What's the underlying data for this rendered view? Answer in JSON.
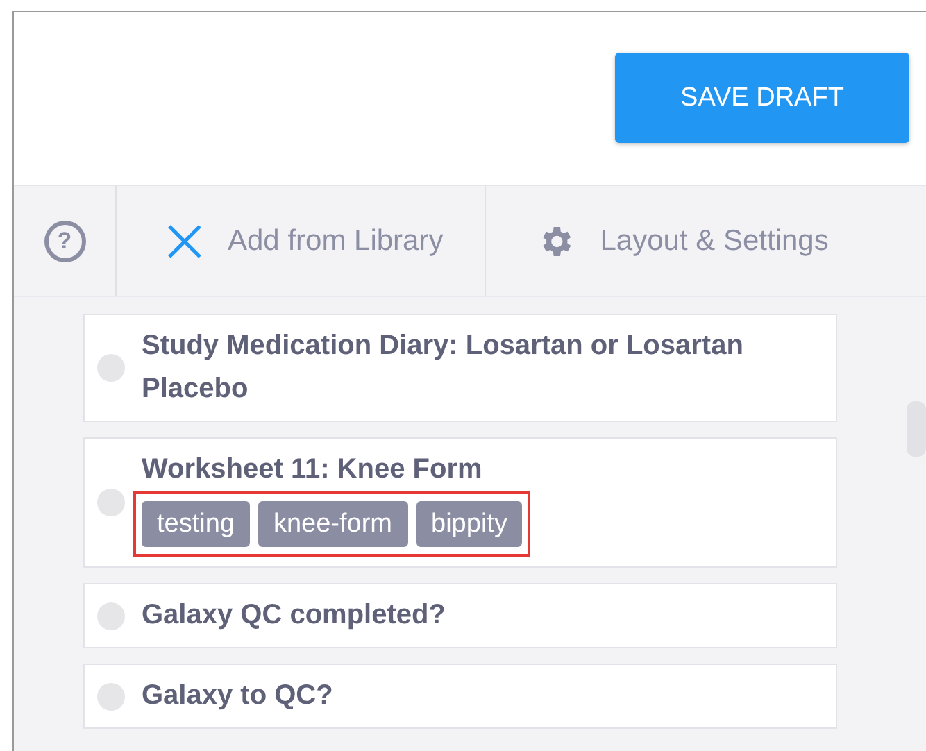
{
  "header": {
    "save_button": "SAVE DRAFT"
  },
  "toolbar": {
    "help": {
      "label": "?"
    },
    "actions": [
      {
        "kind": "add",
        "label": "Add from Library"
      },
      {
        "kind": "settings",
        "label": "Layout & Settings"
      }
    ]
  },
  "items": [
    {
      "title": "Study Medication Diary: Losartan or Losartan Placebo",
      "selected": false
    },
    {
      "title": "Worksheet 11: Knee Form",
      "selected": false,
      "tags": [
        "testing",
        "knee-form",
        "bippity"
      ],
      "tags_highlighted": true
    },
    {
      "title": "Galaxy QC completed?",
      "selected": false
    },
    {
      "title": "Galaxy to QC?",
      "selected": false
    }
  ]
}
